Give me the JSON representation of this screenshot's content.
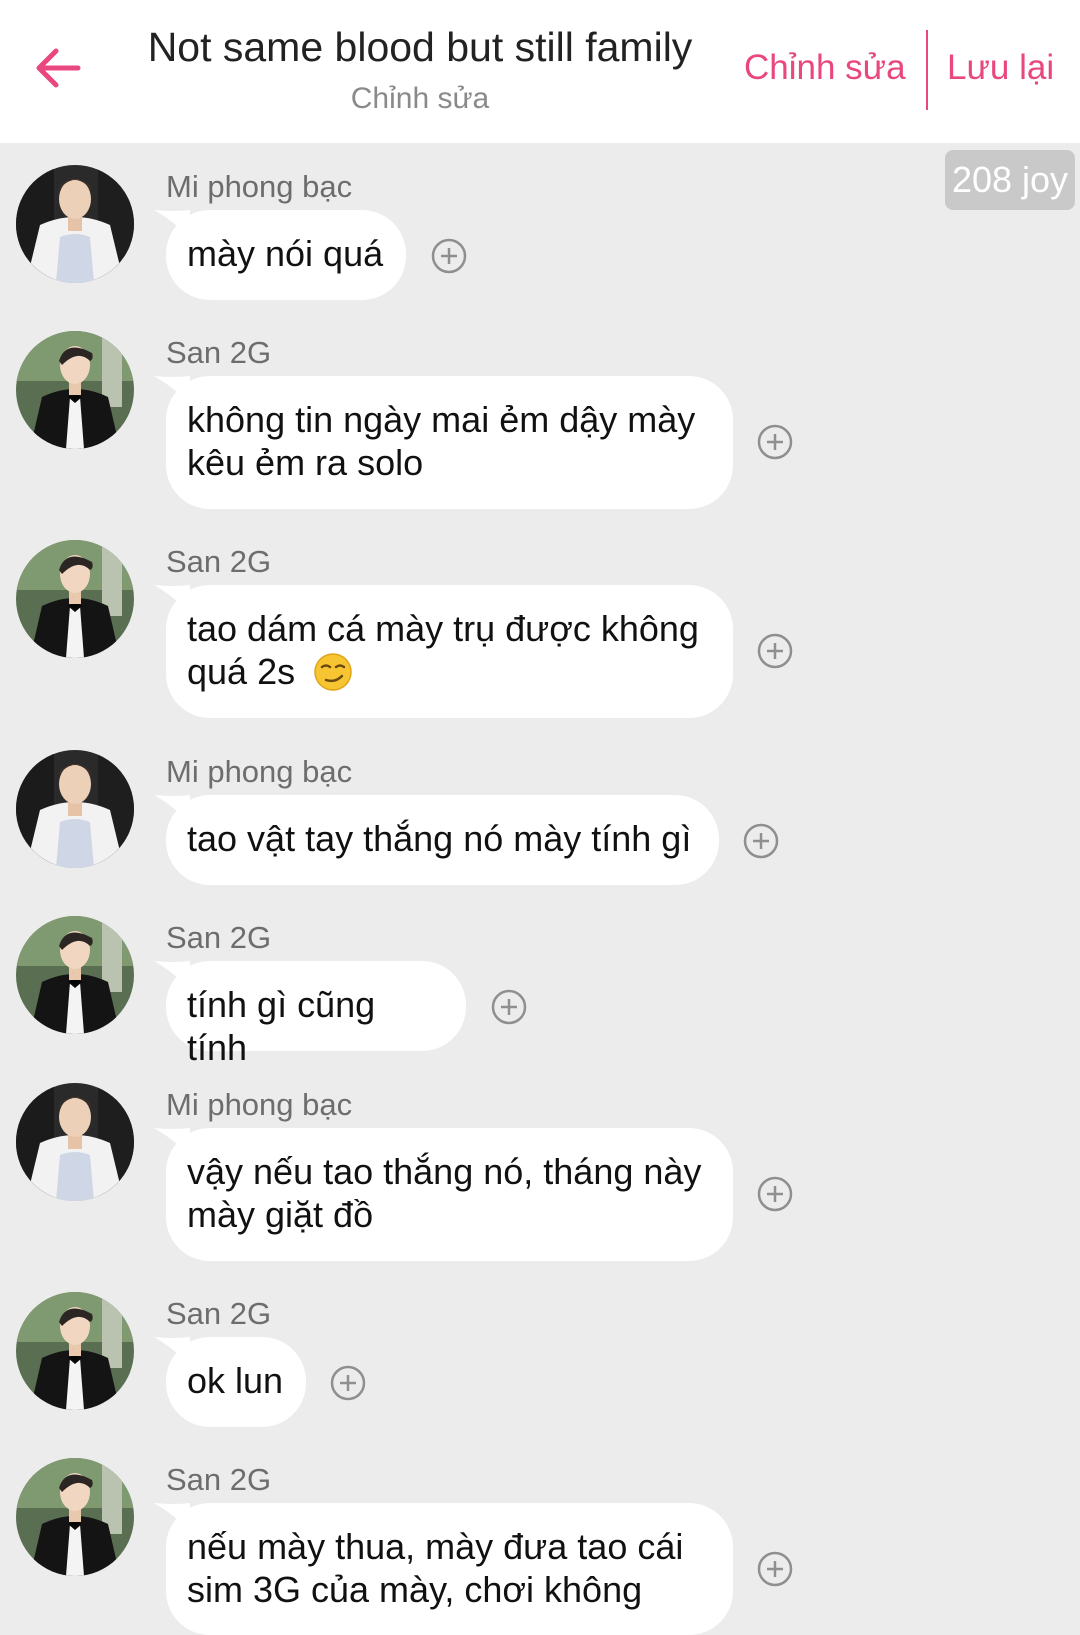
{
  "header": {
    "title": "Not same blood but still family",
    "subtitle": "Chỉnh sửa",
    "edit_label": "Chỉnh sửa",
    "save_label": "Lưu lại",
    "accent_color": "#e8487f"
  },
  "joy_badge": "208 joy",
  "messages": [
    {
      "sender": "Mi phong bạc",
      "text": "mày nói quá"
    },
    {
      "sender": "San 2G",
      "text": "không tin ngày mai ẻm dậy mày kêu ẻm ra solo"
    },
    {
      "sender": "San 2G",
      "text": "tao dám cá mày trụ được không quá 2s",
      "emoji": "smirk-emoji"
    },
    {
      "sender": "Mi phong bạc",
      "text": "tao vật tay thắng nó mày tính gì"
    },
    {
      "sender": "San 2G",
      "text": "tính gì cũng tính"
    },
    {
      "sender": "Mi phong bạc",
      "text": "vậy nếu tao thắng nó, tháng này mày giặt đồ"
    },
    {
      "sender": "San 2G",
      "text": "ok lun"
    },
    {
      "sender": "San 2G",
      "text": "nếu mày thua, mày đưa tao cái sim 3G của mày, chơi không"
    }
  ],
  "icons": {
    "back": "arrow-left-icon",
    "add_reaction": "plus-circle-icon"
  }
}
